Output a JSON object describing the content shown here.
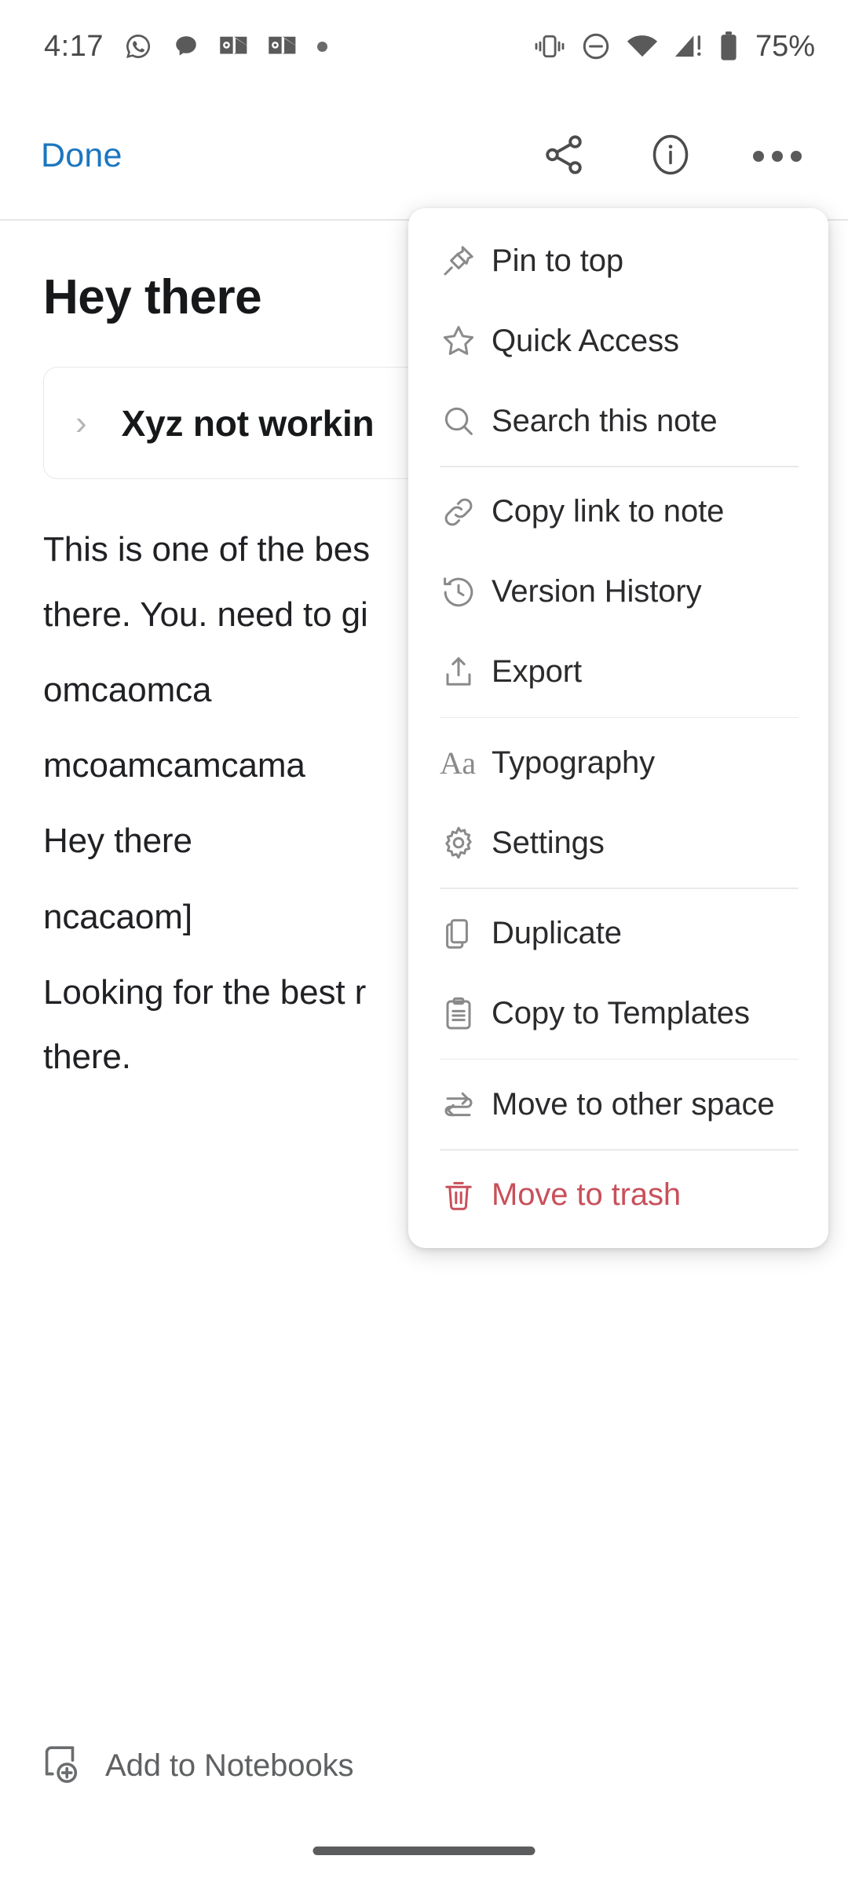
{
  "status_bar": {
    "time": "4:17",
    "battery_percent": "75%",
    "left_icons": [
      "whatsapp-icon",
      "chat-bubble-icon",
      "outlook-icon",
      "outlook-icon",
      "notification-dot-icon"
    ],
    "right_icons": [
      "vibrate-icon",
      "do-not-disturb-icon",
      "wifi-icon",
      "cellular-signal-warning-icon",
      "battery-icon"
    ]
  },
  "toolbar": {
    "done_label": "Done",
    "share_icon": "share-icon",
    "info_icon": "info-circle-icon",
    "overflow_icon": "more-options-icon"
  },
  "note": {
    "title": "Hey there",
    "toggle_block": {
      "chevron_icon": "chevron-right-icon",
      "text": "Xyz not workin"
    },
    "paragraphs": [
      {
        "text": "This is one of the bes",
        "spacing": "sm"
      },
      {
        "text": "there. You. need to gi",
        "spacing": "lg"
      },
      {
        "text": "omcaomca",
        "spacing": "lg"
      },
      {
        "text": "mcoamcamcama",
        "spacing": "lg"
      },
      {
        "text": "Hey there",
        "spacing": "lg"
      },
      {
        "text": "ncacaom]",
        "spacing": "lg"
      },
      {
        "text": "Looking for the best r",
        "spacing": "sm"
      },
      {
        "text": "there.",
        "spacing": "sm"
      }
    ]
  },
  "menu": {
    "items": [
      {
        "label": "Pin to top",
        "icon": "pin-icon",
        "divider_after": false,
        "danger": false
      },
      {
        "label": "Quick Access",
        "icon": "star-icon",
        "divider_after": false,
        "danger": false
      },
      {
        "label": "Search this note",
        "icon": "search-icon",
        "divider_after": true,
        "danger": false
      },
      {
        "label": "Copy link to note",
        "icon": "link-icon",
        "divider_after": false,
        "danger": false
      },
      {
        "label": "Version History",
        "icon": "history-clock-icon",
        "divider_after": false,
        "danger": false
      },
      {
        "label": "Export",
        "icon": "export-upload-icon",
        "divider_after": true,
        "danger": false
      },
      {
        "label": "Typography",
        "icon": "typography-aa-icon",
        "divider_after": false,
        "danger": false
      },
      {
        "label": "Settings",
        "icon": "gear-icon",
        "divider_after": true,
        "danger": false
      },
      {
        "label": "Duplicate",
        "icon": "duplicate-pages-icon",
        "divider_after": false,
        "danger": false
      },
      {
        "label": "Copy to Templates",
        "icon": "clipboard-icon",
        "divider_after": true,
        "danger": false
      },
      {
        "label": "Move to other space",
        "icon": "swap-arrows-icon",
        "divider_after": true,
        "danger": false
      },
      {
        "label": "Move to trash",
        "icon": "trash-icon",
        "divider_after": false,
        "danger": true
      }
    ]
  },
  "bottom_bar": {
    "label": "Add to Notebooks",
    "icon": "notebook-add-icon"
  },
  "colors": {
    "accent_blue": "#1b76c0",
    "danger_red": "#c8505a",
    "text_primary": "#202124",
    "icon_gray": "#8a8a8a"
  }
}
